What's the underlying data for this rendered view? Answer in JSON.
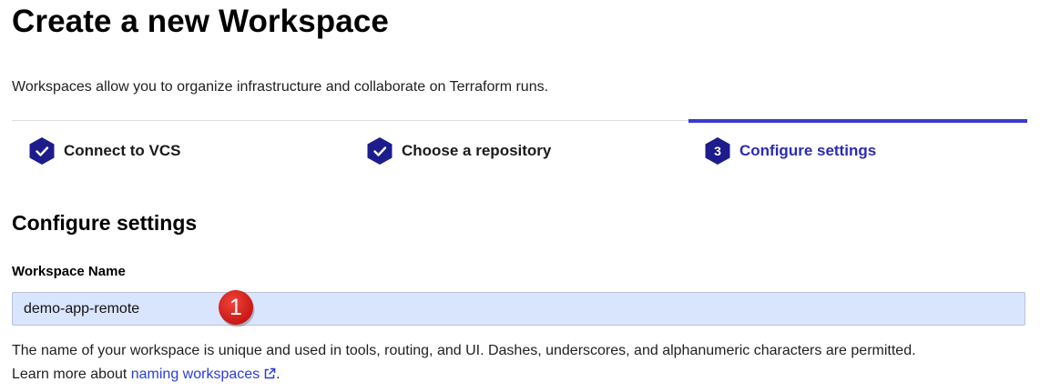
{
  "header": {
    "title": "Create a new Workspace",
    "subtitle": "Workspaces allow you to organize infrastructure and collaborate on Terraform runs."
  },
  "steps": [
    {
      "label": "Connect to VCS",
      "status": "complete",
      "icon": "check-icon"
    },
    {
      "label": "Choose a repository",
      "status": "complete",
      "icon": "check-icon"
    },
    {
      "label": "Configure settings",
      "status": "active",
      "number": "3"
    }
  ],
  "colors": {
    "accent": "#3a3ad2",
    "step_complete": "#1c1c8c",
    "input_bg": "#d9e5fc",
    "link": "#2b3cd6",
    "badge": "#e0201b"
  },
  "section": {
    "title": "Configure settings"
  },
  "workspace_name": {
    "label": "Workspace Name",
    "value": "demo-app-remote",
    "annotation_badge": "1"
  },
  "help": {
    "text": "The name of your workspace is unique and used in tools, routing, and UI. Dashes, underscores, and alphanumeric characters are permitted.",
    "learn_prefix": "Learn more about ",
    "link_text": "naming workspaces",
    "suffix": ".",
    "link_icon": "external-link-icon"
  }
}
